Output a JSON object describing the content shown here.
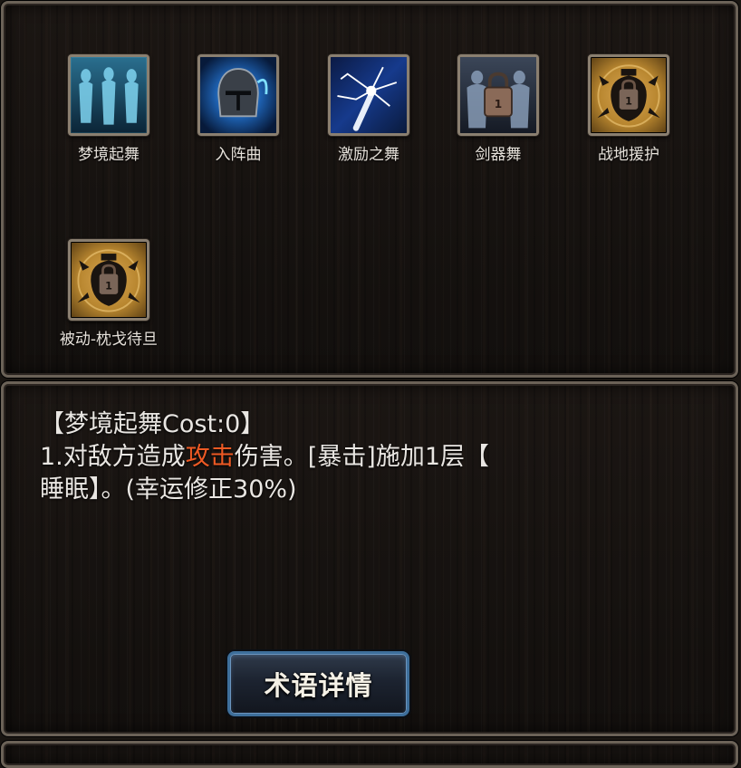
{
  "skills": [
    {
      "name": "梦境起舞",
      "icon": "dancers-icon",
      "locked": false
    },
    {
      "name": "入阵曲",
      "icon": "helmet-icon",
      "locked": false
    },
    {
      "name": "激励之舞",
      "icon": "lightning-icon",
      "locked": false
    },
    {
      "name": "剑器舞",
      "icon": "warriors-icon",
      "locked": true,
      "lock_level": "1"
    },
    {
      "name": "战地援护",
      "icon": "locked-crest-icon",
      "locked": true,
      "lock_level": "1"
    },
    {
      "name": "被动-枕戈待旦",
      "icon": "locked-crest-icon",
      "locked": true,
      "lock_level": "1"
    }
  ],
  "description": {
    "title": "【梦境起舞Cost:0】",
    "line1_prefix": "1.对敌方造成",
    "line1_highlight": "攻击",
    "line1_suffix": "伤害。[暴击]施加1层【",
    "line2": "睡眠】。(幸运修正30%)",
    "highlight_color": "#ee5a24"
  },
  "details_button": {
    "label": "术语详情"
  }
}
